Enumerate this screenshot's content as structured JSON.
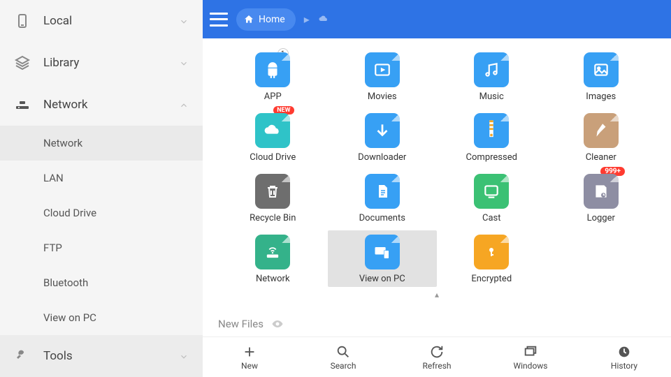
{
  "sidebar": {
    "local": "Local",
    "library": "Library",
    "network": "Network",
    "tools": "Tools",
    "sub": {
      "network": "Network",
      "lan": "LAN",
      "cloud": "Cloud Drive",
      "ftp": "FTP",
      "bluetooth": "Bluetooth",
      "viewpc": "View on PC"
    }
  },
  "topbar": {
    "home": "Home"
  },
  "tiles": {
    "app": "APP",
    "movies": "Movies",
    "music": "Music",
    "images": "Images",
    "cloud": "Cloud Drive",
    "downloader": "Downloader",
    "compressed": "Compressed",
    "cleaner": "Cleaner",
    "recycle": "Recycle Bin",
    "documents": "Documents",
    "cast": "Cast",
    "logger": "Logger",
    "network": "Network",
    "viewpc": "View on PC",
    "encrypted": "Encrypted"
  },
  "badges": {
    "app": "1",
    "cloud": "NEW",
    "logger": "999+"
  },
  "section": {
    "newfiles": "New Files"
  },
  "bottom": {
    "new": "New",
    "search": "Search",
    "refresh": "Refresh",
    "windows": "Windows",
    "history": "History"
  },
  "colors": {
    "blue": "#37A0F4",
    "darkblue": "#2E73E5",
    "teal": "#2FC3C8",
    "darkgray": "#6E6E6E",
    "green": "#3BC174",
    "tan": "#C9A07A",
    "purplegray": "#8E8EA3",
    "orange": "#F6A623",
    "bluegreen": "#34B28A"
  }
}
